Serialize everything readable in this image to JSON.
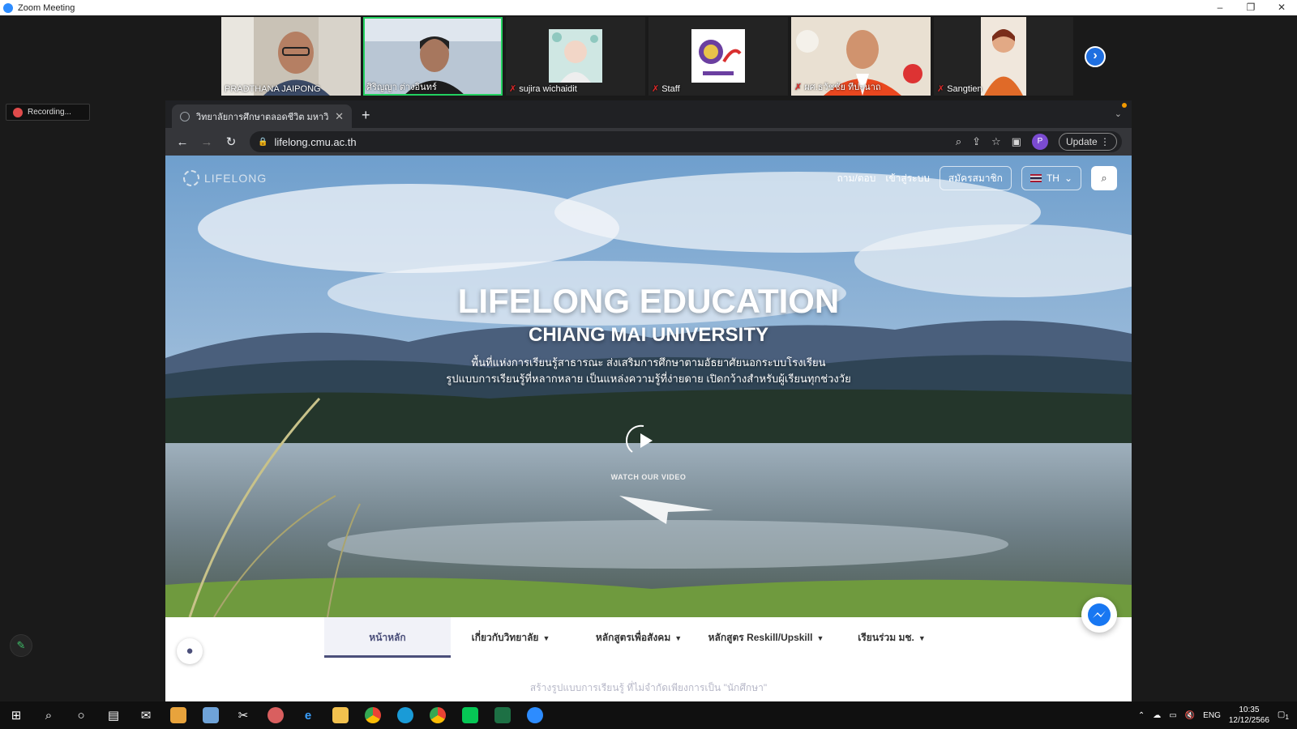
{
  "zoom": {
    "title": "Zoom Meeting",
    "recording_label": "Recording...",
    "participants": [
      {
        "name": "PRADTHANA JAIPONG",
        "muted": false
      },
      {
        "name": "ศิริญญา ต่างอินทร์",
        "muted": false
      },
      {
        "name": "sujira wichaidit",
        "muted": true
      },
      {
        "name": "Staff",
        "muted": true
      },
      {
        "name": "ผศ.ธวัชชัย ทีปะนาถ",
        "muted": true
      },
      {
        "name": "Sangtien",
        "muted": true
      }
    ]
  },
  "browser": {
    "tab_title": "วิทยาลัยการศึกษาตลอดชีวิต มหาวิ",
    "url": "lifelong.cmu.ac.th",
    "update_label": "Update",
    "profile_initial": "P"
  },
  "site": {
    "logo_text": "LIFELONG",
    "nav_links": [
      "ถาม/ตอบ",
      "เข้าสู่ระบบ"
    ],
    "register_label": "สมัครสมาชิก",
    "lang_label": "TH",
    "hero_title": "LIFELONG EDUCATION",
    "hero_subtitle": "CHIANG MAI UNIVERSITY",
    "hero_desc_line1": "พื้นที่แห่งการเรียนรู้สาธารณะ ส่งเสริมการศึกษาตามอัธยาศัยนอกระบบโรงเรียน",
    "hero_desc_line2": "รูปแบบการเรียนรู้ที่หลากหลาย เป็นแหล่งความรู้ที่ง่ายดาย เปิดกว้างสำหรับผู้เรียนทุกช่วงวัย",
    "watch_label": "WATCH OUR VIDEO",
    "menu": [
      {
        "label": "หน้าหลัก",
        "dropdown": false
      },
      {
        "label": "เกี่ยวกับวิทยาลัย",
        "dropdown": true
      },
      {
        "label": "หลักสูตรเพื่อสังคม",
        "dropdown": true
      },
      {
        "label": "หลักสูตร Reskill/Upskill",
        "dropdown": true
      },
      {
        "label": "เรียนร่วม มช.",
        "dropdown": true
      }
    ],
    "below_text": "สร้างรูปแบบการเรียนรู้ ที่ไม่จำกัดเพียงการเป็น \"นักศึกษา\""
  },
  "taskbar": {
    "lang": "ENG",
    "time": "10:35",
    "date": "12/12/2566",
    "notifications": "1"
  },
  "colors": {
    "zoom_blue": "#2D8CFF",
    "site_accent": "#4b4f7a",
    "chrome_dark": "#202124"
  }
}
